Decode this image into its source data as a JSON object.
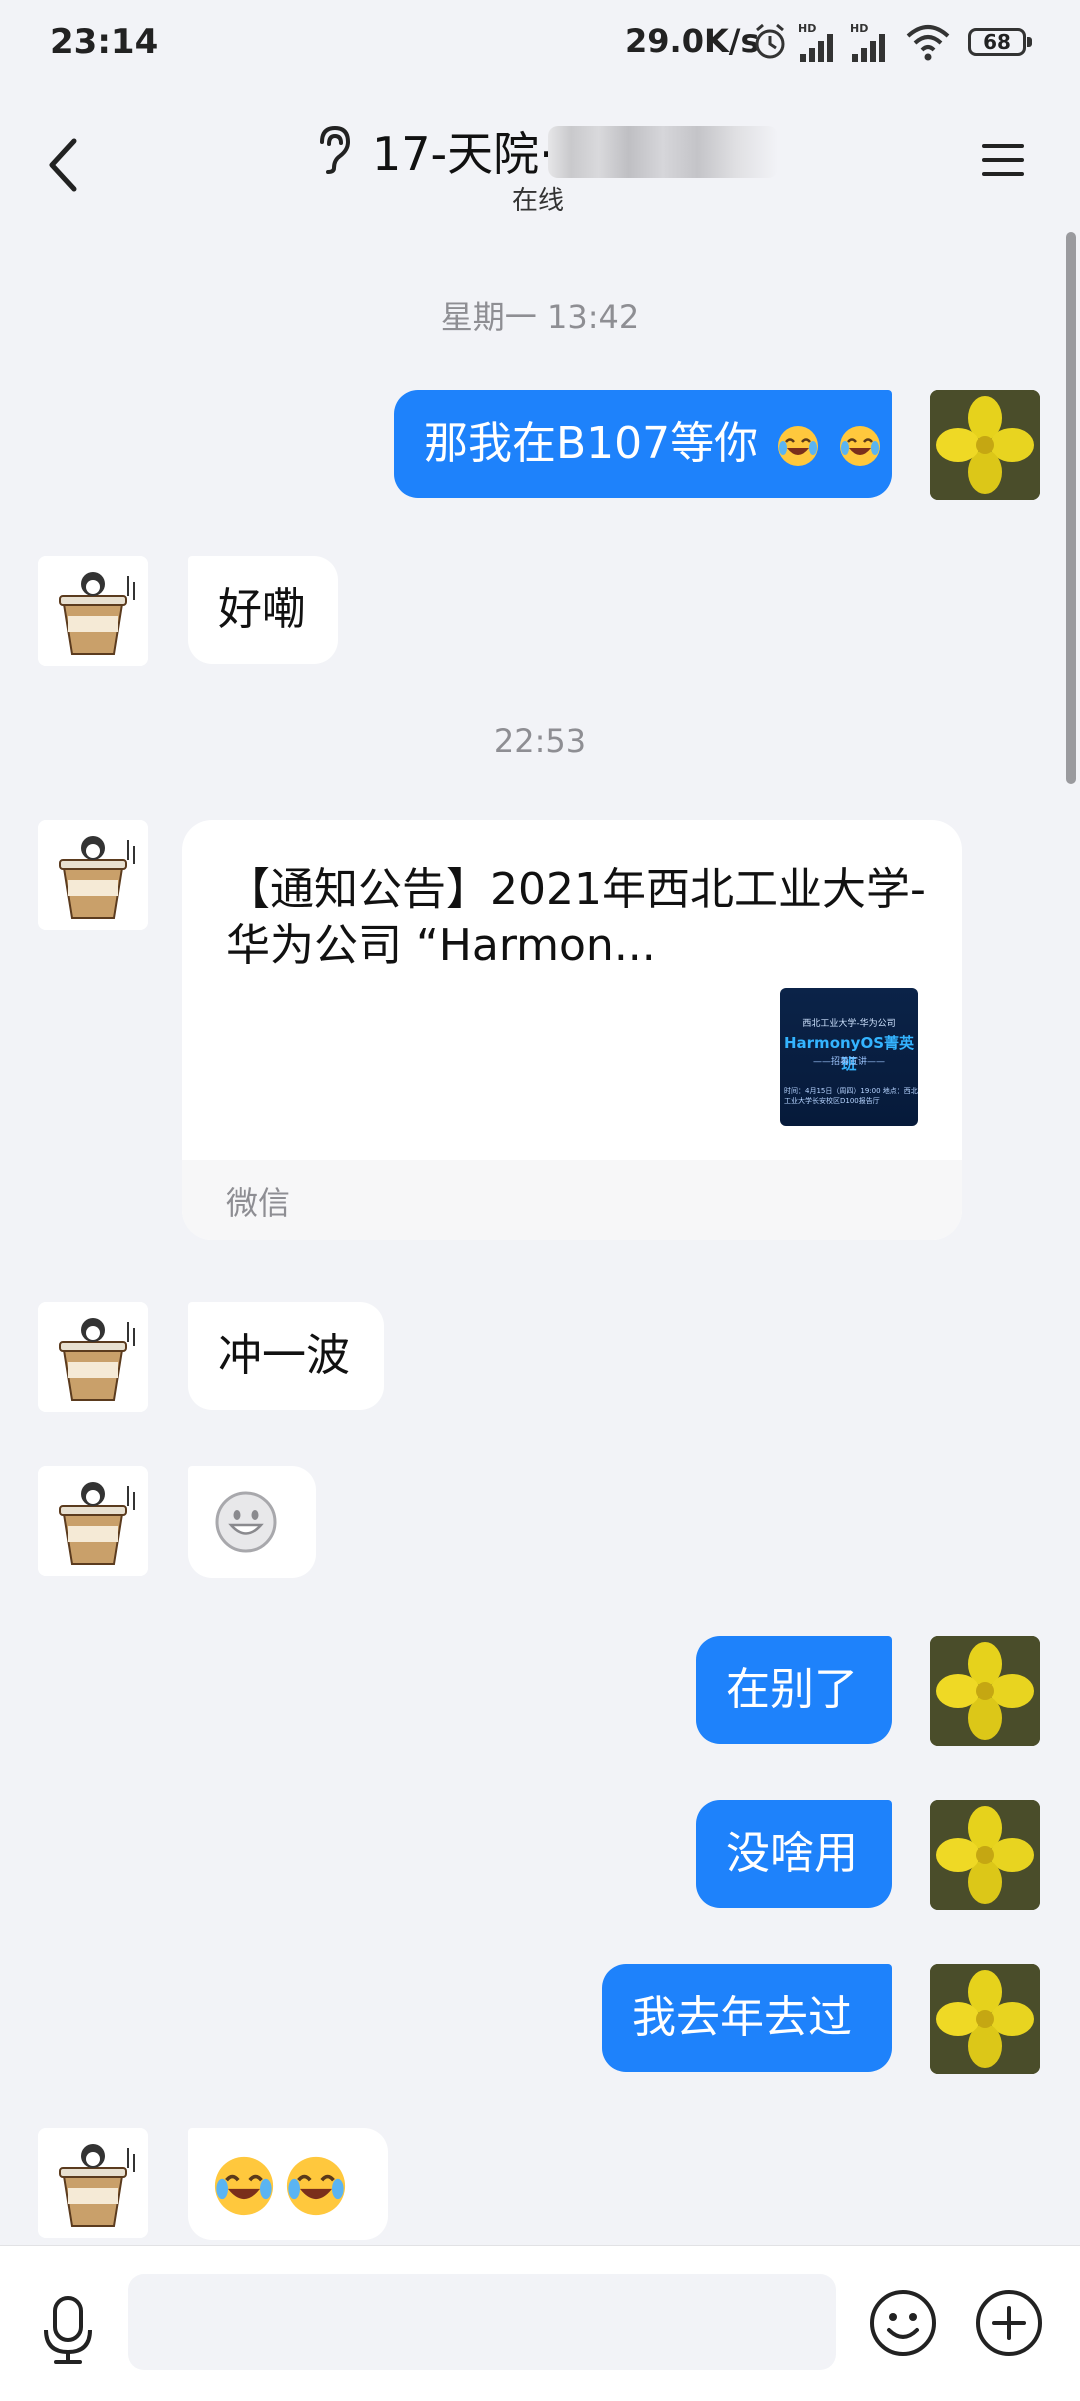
{
  "status_bar": {
    "time": "23:14",
    "network_speed": "29.0K/s",
    "battery": "68"
  },
  "header": {
    "title": "17-天院·",
    "presence": "在线"
  },
  "timestamps": {
    "t1": "星期一 13:42",
    "t2": "22:53"
  },
  "messages": {
    "m1": "那我在B107等你",
    "m2": "好嘞",
    "m4": "冲一波",
    "m6": "在别了",
    "m7": "没啥用",
    "m8": "我去年去过"
  },
  "share_card": {
    "title": "【通知公告】2021年西北工业大学-华为公司 “Harmon...",
    "source": "微信",
    "thumb_line1": "西北工业大学-华为公司",
    "thumb_line2": "HarmonyOS菁英班",
    "thumb_line3": "——招募宣讲——",
    "thumb_line4": "时间：4月15日（周四）19:00 地点：西北工业大学长安校区D100报告厅"
  },
  "icons": {
    "back": "back-icon",
    "ear": "ear-mode-icon",
    "menu": "menu-icon",
    "mic": "microphone-icon",
    "emoji": "emoji-icon",
    "plus": "add-icon"
  },
  "colors": {
    "my_bubble": "#1e82fb",
    "other_bubble": "#ffffff",
    "background": "#f2f3f7"
  }
}
